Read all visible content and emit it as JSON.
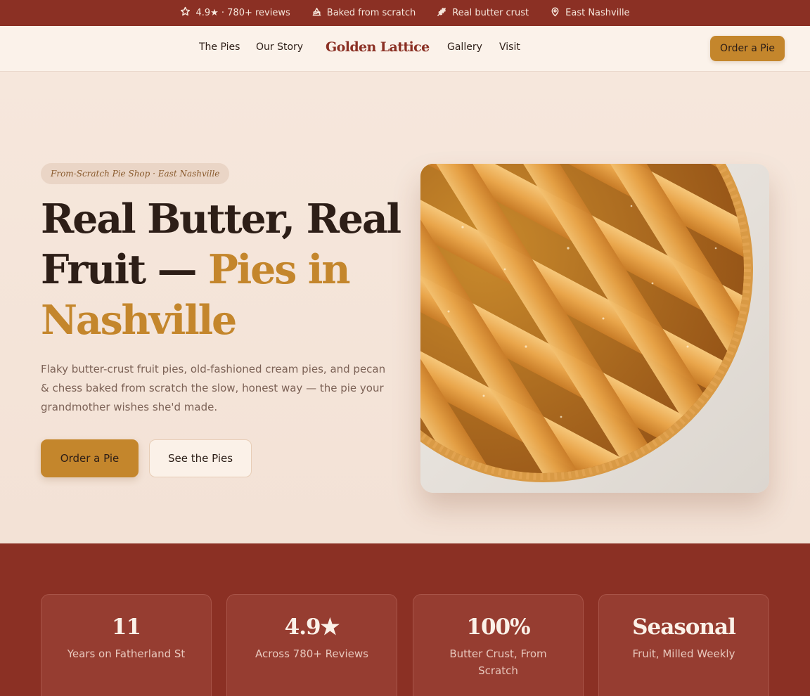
{
  "topbar": {
    "items": [
      {
        "icon": "star-icon",
        "text": "4.9★ · 780+ reviews"
      },
      {
        "icon": "cake-icon",
        "text": "Baked from scratch"
      },
      {
        "icon": "wheat-icon",
        "text": "Real butter crust"
      },
      {
        "icon": "map-pin-icon",
        "text": "East Nashville"
      }
    ]
  },
  "nav": {
    "brand": "Golden Lattice",
    "links": [
      "The Pies",
      "Our Story",
      "Gallery",
      "Visit"
    ],
    "cta": "Order a Pie"
  },
  "hero": {
    "eyebrow": "From-Scratch Pie Shop · East Nashville",
    "headline_part1": "Real Butter, Real Fruit — ",
    "headline_accent": "Pies in Nashville",
    "lede": "Flaky butter-crust fruit pies, old-fashioned cream pies, and pecan & chess baked from scratch the slow, honest way — the pie your grandmother wishes she'd made.",
    "primary_cta": "Order a Pie",
    "secondary_cta": "See the Pies",
    "image_subject": "lattice-pie-photo"
  },
  "stats": [
    {
      "value": "11",
      "label": "Years on Fatherland St"
    },
    {
      "value": "4.9★",
      "label": "Across 780+ Reviews"
    },
    {
      "value": "100%",
      "label": "Butter Crust, From Scratch"
    },
    {
      "value": "Seasonal",
      "label": "Fruit, Milled Weekly"
    }
  ],
  "colors": {
    "brand_red": "#8b3024",
    "gold": "#c4862c",
    "cream": "#fbf2ea",
    "hero_bg": "#f5e6dc",
    "ink": "#2d1e17"
  }
}
